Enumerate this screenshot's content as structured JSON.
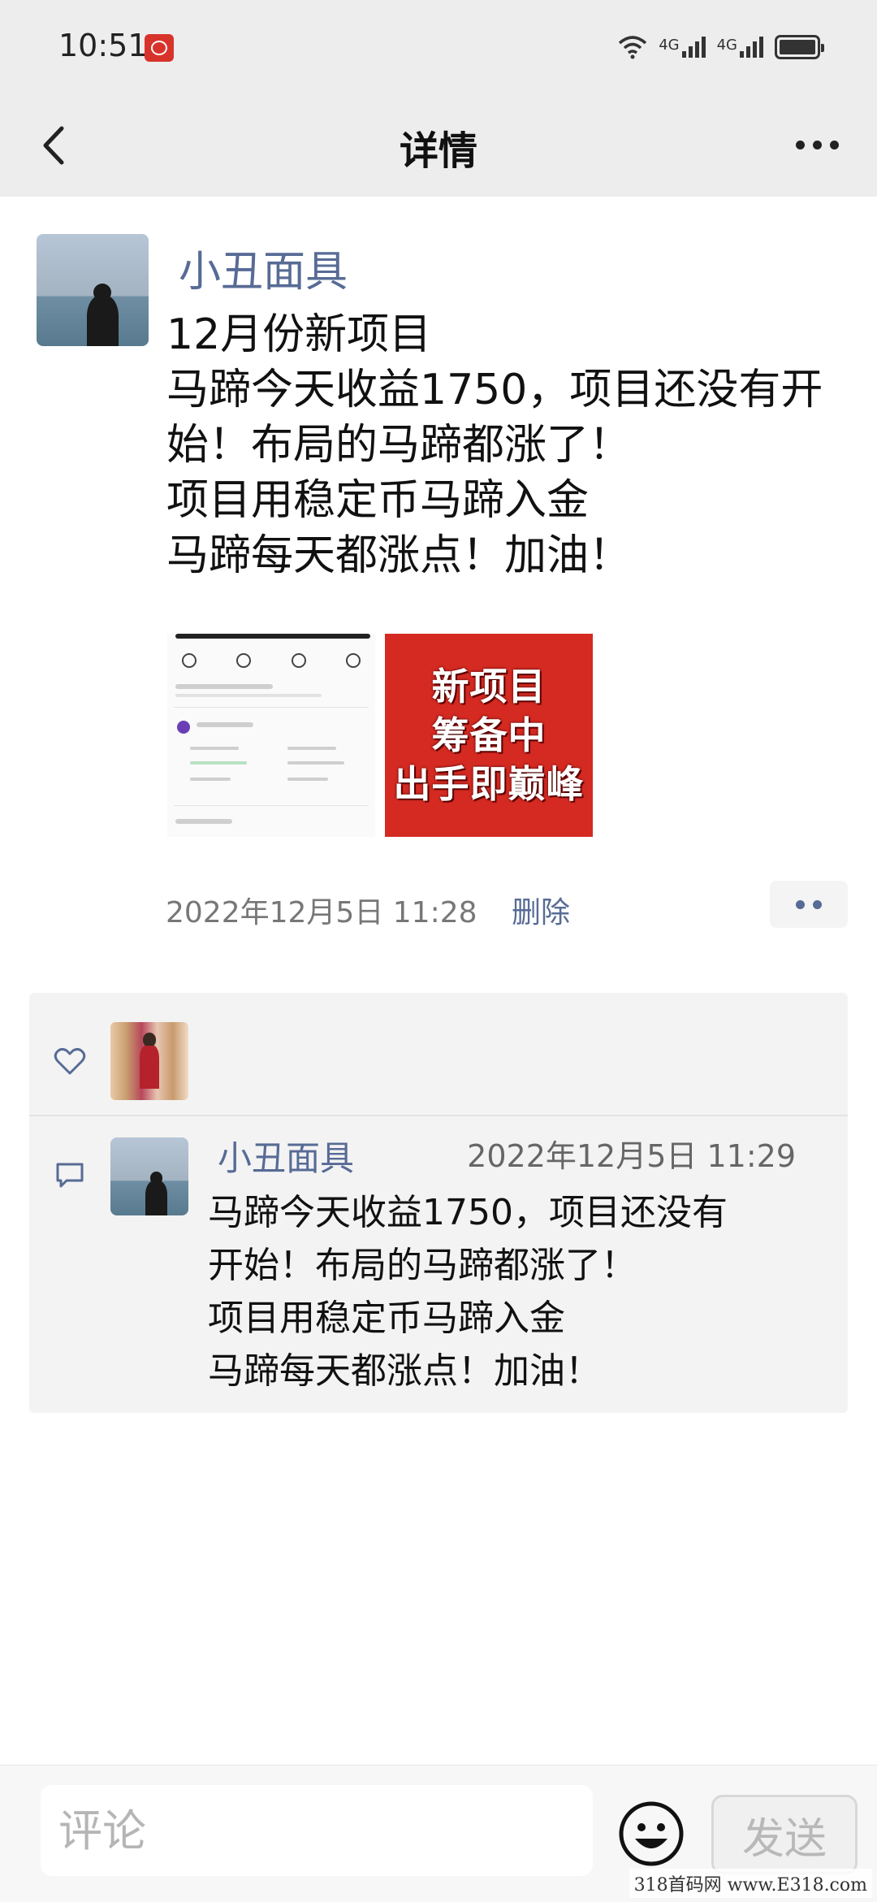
{
  "status_bar": {
    "time": "10:51",
    "network_1": "4G",
    "network_2": "4G"
  },
  "nav": {
    "title": "详情"
  },
  "post": {
    "author": "小丑面具",
    "text": "12月份新项目\n马蹄今天收益1750，项目还没有开始！布局的马蹄都涨了！\n项目用稳定币马蹄入金\n马蹄每天都涨点！加油！",
    "image2_lines": [
      "新项目",
      "筹备中",
      "出手即巅峰"
    ],
    "timestamp": "2022年12月5日 11:28",
    "delete_label": "删除"
  },
  "comment": {
    "author": "小丑面具",
    "timestamp": "2022年12月5日 11:29",
    "text": "马蹄今天收益1750，项目还没有\n开始！布局的马蹄都涨了！\n项目用稳定币马蹄入金\n马蹄每天都涨点！加油！"
  },
  "bottom_bar": {
    "placeholder": "评论",
    "send_label": "发送"
  },
  "watermark": "318首码网 www.E318.com",
  "colors": {
    "link": "#576b95",
    "bar_bg": "#ededed",
    "image_red": "#d42a22"
  }
}
